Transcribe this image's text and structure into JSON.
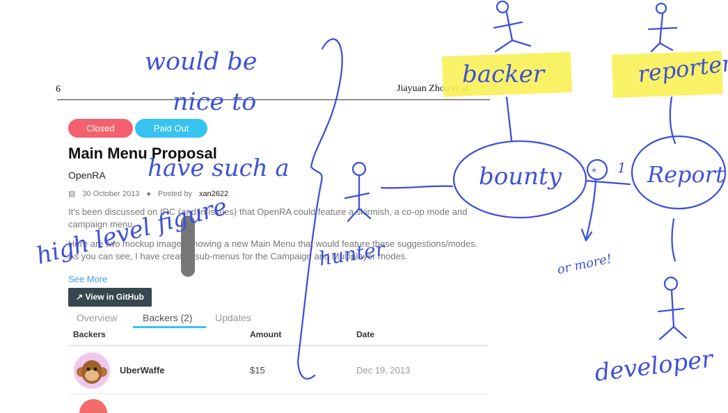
{
  "paper": {
    "page_number": "6",
    "running_author": "Jiayuan Zhou et al."
  },
  "screenshot": {
    "badges": {
      "closed": "Closed",
      "paid": "Paid Out"
    },
    "title": "Main Menu Proposal",
    "project": "OpenRA",
    "meta": {
      "date": "30 October 2013",
      "posted_by_label": "Posted by",
      "author": "xan2622"
    },
    "description": {
      "paragraph1": "It's been discussed on IRC (and in issues) that OpenRA could feature a skirmish, a co-op mode and campaign menu.",
      "paragraph2": "Here are two mockup images showing a new Main Menu that would feature these suggestions/modes. As you can see, I have created sub-menus for the Campaign and Multiplayer modes."
    },
    "see_more": "See More",
    "github_button": "View in GitHub",
    "tabs": [
      {
        "label": "Overview"
      },
      {
        "label": "Backers (2)"
      },
      {
        "label": "Updates"
      }
    ],
    "columns": {
      "backers": "Backers",
      "amount": "Amount",
      "date": "Date"
    },
    "rows": [
      {
        "name": "UberWaffe",
        "amount": "$15",
        "date": "Dec 19, 2013"
      }
    ]
  },
  "annotations": {
    "comment": [
      "would be",
      "nice to",
      "have such a",
      "high level figure"
    ],
    "roles": {
      "backer": "backer",
      "reporter": "reporter",
      "developer": "developer",
      "hunter": "hunter"
    },
    "entities": {
      "bounty": "bounty",
      "report": "Report"
    },
    "multiplicity": {
      "one": "1",
      "many": "*",
      "many_note": "or more!"
    }
  },
  "colors": {
    "ink": "#3d51d9",
    "highlight": "#f8ef55",
    "closed": "#f4606d",
    "paid_out": "#37c3f1"
  }
}
